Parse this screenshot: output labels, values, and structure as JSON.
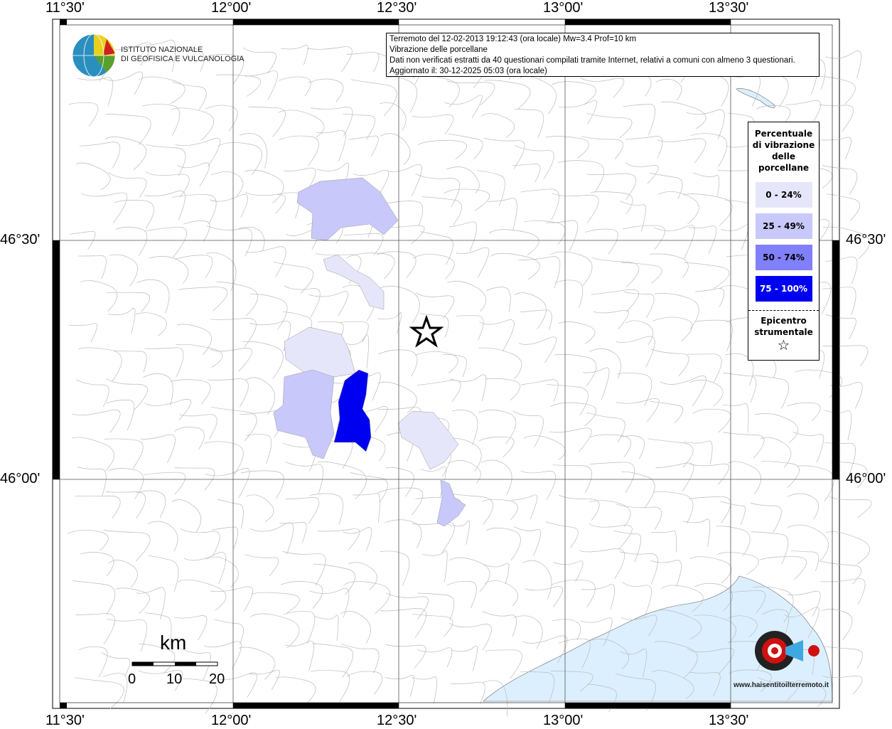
{
  "axes": {
    "lon_labels": [
      "11°30'",
      "12°00'",
      "12°30'",
      "13°00'",
      "13°30'"
    ],
    "lat_labels": [
      "46°30'",
      "46°00'"
    ]
  },
  "info": {
    "line1": "Terremoto del 12-02-2013 19:12:43 (ora locale) Mw=3.4 Prof=10 km",
    "line2": "Vibrazione delle porcellane",
    "line3": "Dati non verificati estratti da 40 questionari compilati tramite Internet, relativi a comuni con almeno 3 questionari.",
    "line4": "Aggiornato il: 30-12-2025 05:03 (ora locale)"
  },
  "logo": {
    "line1": "ISTITUTO NAZIONALE",
    "line2": "DI GEOFISICA E VULCANOLOGIA"
  },
  "legend": {
    "title_lines": [
      "Percentuale",
      "di vibrazione",
      "delle",
      "porcellane"
    ],
    "classes": [
      {
        "label": "0 - 24%",
        "color": "#e6e6fa"
      },
      {
        "label": "25 - 49%",
        "color": "#c8c8fa"
      },
      {
        "label": "50 - 74%",
        "color": "#8080fa"
      },
      {
        "label": "75 - 100%",
        "color": "#0000f0"
      }
    ],
    "epicenter_lines": [
      "Epicentro",
      "strumentale"
    ],
    "epicenter_symbol": "☆"
  },
  "scale": {
    "unit": "km",
    "ticks": [
      "0",
      "10",
      "20"
    ]
  },
  "brand": {
    "text": "www.haisentitoilterremoto.it"
  },
  "colors": {
    "sea": "#dcefff",
    "border": "#c8c8c8"
  }
}
